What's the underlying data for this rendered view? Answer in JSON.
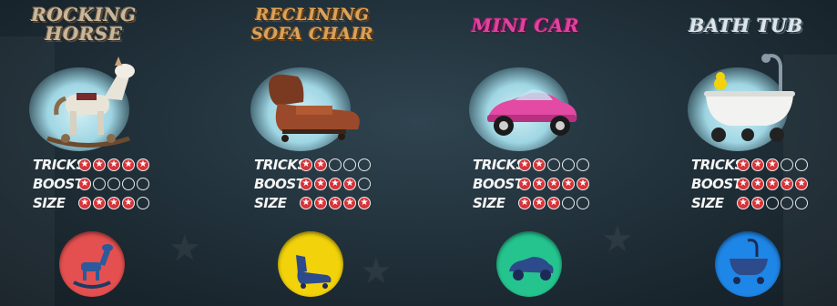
{
  "vehicles": [
    {
      "title_lines": [
        "ROCKING",
        "HORSE"
      ],
      "title_color": "#c9b79a",
      "badge_color": "#e4504f",
      "badge_icon": "rocking-horse-icon",
      "stats": {
        "tricks": {
          "label": "TRICKS",
          "value": 5,
          "max": 5
        },
        "boost": {
          "label": "BOOST",
          "value": 1,
          "max": 5
        },
        "size": {
          "label": "SIZE",
          "value": 4,
          "max": 5
        }
      }
    },
    {
      "title_lines": [
        "RECLINING",
        "SOFA CHAIR"
      ],
      "title_color": "#d9a35a",
      "badge_color": "#f2d20a",
      "badge_icon": "sofa-chair-icon",
      "stats": {
        "tricks": {
          "label": "TRICKS",
          "value": 2,
          "max": 5
        },
        "boost": {
          "label": "BOOST",
          "value": 4,
          "max": 5
        },
        "size": {
          "label": "SIZE",
          "value": 5,
          "max": 5
        }
      }
    },
    {
      "title_lines": [
        "MINI CAR"
      ],
      "title_color": "#e0439e",
      "badge_color": "#25c48f",
      "badge_icon": "mini-car-icon",
      "stats": {
        "tricks": {
          "label": "TRICKS",
          "value": 2,
          "max": 5
        },
        "boost": {
          "label": "BOOST",
          "value": 5,
          "max": 5
        },
        "size": {
          "label": "SIZE",
          "value": 3,
          "max": 5
        }
      }
    },
    {
      "title_lines": [
        "BATH TUB"
      ],
      "title_color": "#dfe6ea",
      "badge_color": "#1e86e6",
      "badge_icon": "bath-tub-icon",
      "stats": {
        "tricks": {
          "label": "TRICKS",
          "value": 3,
          "max": 5
        },
        "boost": {
          "label": "BOOST",
          "value": 5,
          "max": 5
        },
        "size": {
          "label": "SIZE",
          "value": 2,
          "max": 5
        }
      }
    }
  ]
}
